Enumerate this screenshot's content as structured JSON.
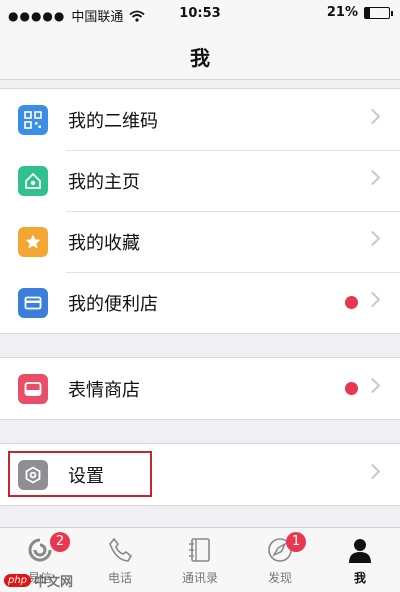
{
  "status_bar": {
    "signal_dots": "●●●●●",
    "carrier": "中国联通",
    "time": "10:53",
    "battery_text": "21%",
    "battery_level": 0.21
  },
  "nav": {
    "title": "我"
  },
  "groups": [
    {
      "items": [
        {
          "label": "我的二维码",
          "icon": "qr-code-icon",
          "color": "#3a8ee6",
          "red_dot": false
        },
        {
          "label": "我的主页",
          "icon": "home-page-icon",
          "color": "#2fc28f",
          "red_dot": false
        },
        {
          "label": "我的收藏",
          "icon": "star-icon",
          "color": "#f3a632",
          "red_dot": false
        },
        {
          "label": "我的便利店",
          "icon": "wallet-card-icon",
          "color": "#3a7fd9",
          "red_dot": true
        }
      ]
    },
    {
      "items": [
        {
          "label": "表情商店",
          "icon": "sticker-store-icon",
          "color": "#e8506a",
          "red_dot": true
        }
      ]
    },
    {
      "items": [
        {
          "label": "设置",
          "icon": "gear-icon",
          "color": "#8e8e93",
          "red_dot": false
        }
      ]
    }
  ],
  "tabs": [
    {
      "label": "易信",
      "badge": "2",
      "icon": "message-icon"
    },
    {
      "label": "电话",
      "badge": "",
      "icon": "phone-icon"
    },
    {
      "label": "通讯录",
      "badge": "",
      "icon": "contacts-icon"
    },
    {
      "label": "发现",
      "badge": "1",
      "icon": "compass-icon"
    },
    {
      "label": "我",
      "badge": "",
      "icon": "profile-icon",
      "active": true
    }
  ],
  "watermark": {
    "logo": "php",
    "text": "中文网"
  }
}
